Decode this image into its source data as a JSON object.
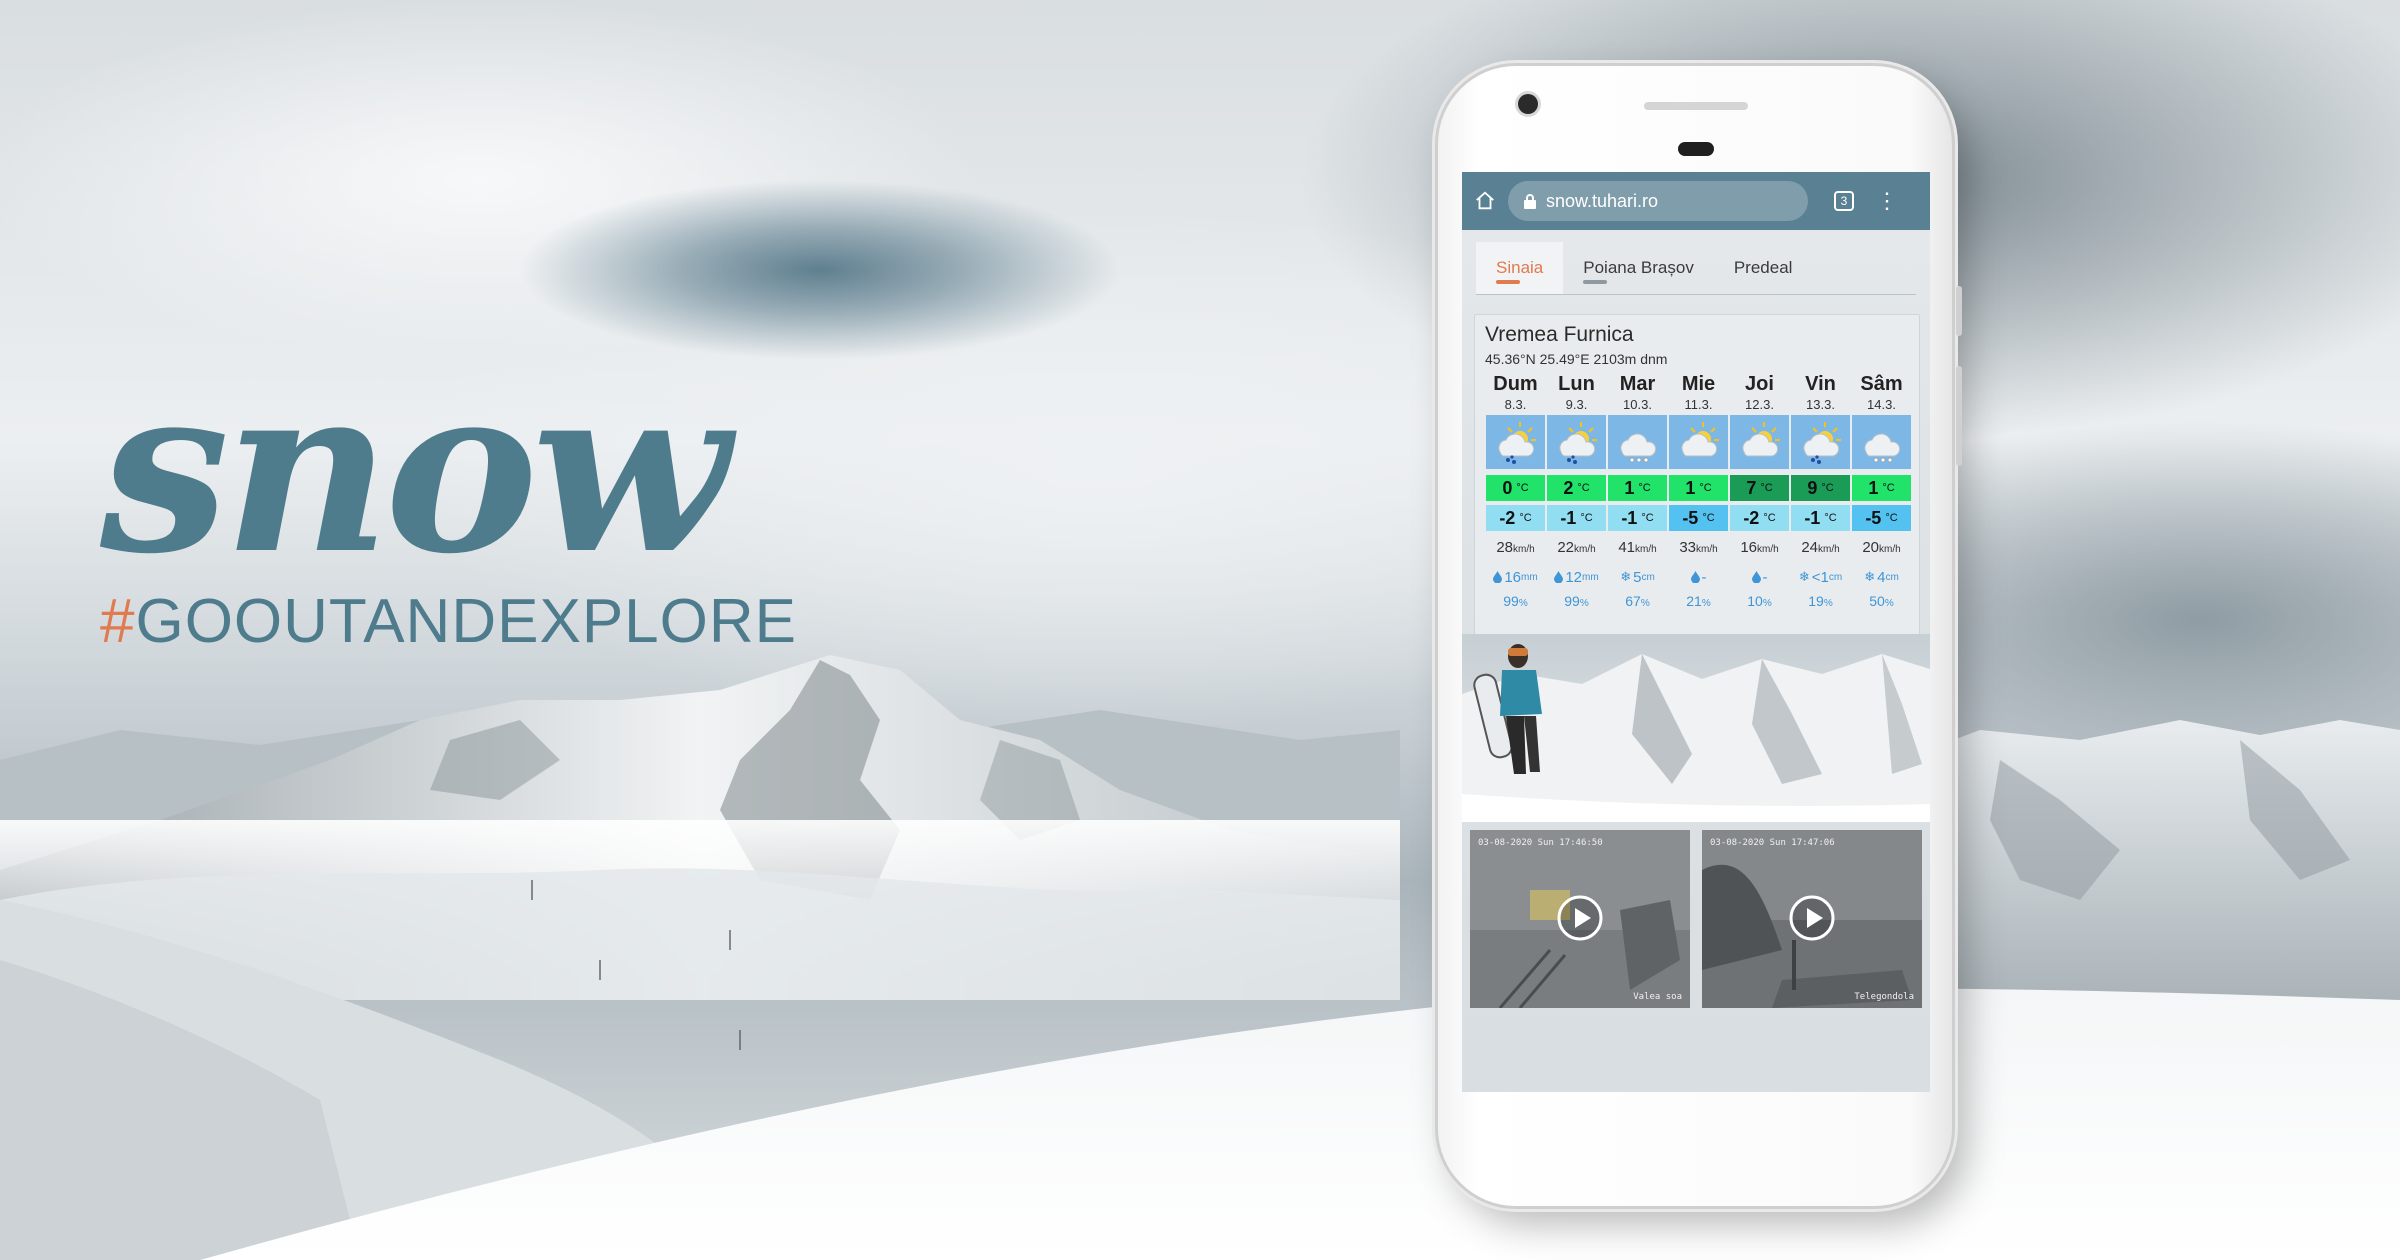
{
  "brand": {
    "word": "snow",
    "hash": "#",
    "tagline": "GOOUTANDEXPLORE",
    "colors": {
      "primary": "#4e7c8c",
      "accent": "#e07a4f"
    }
  },
  "browser": {
    "url": "snow.tuhari.ro",
    "tab_count": "3",
    "home_icon": "home-icon",
    "lock_icon": "lock-icon",
    "menu_icon": "more-vert-icon"
  },
  "locations": [
    {
      "label": "Sinaia",
      "active": true
    },
    {
      "label": "Poiana Brașov",
      "active": false
    },
    {
      "label": "Predeal",
      "active": false
    }
  ],
  "forecast": {
    "title": "Vremea Furnica",
    "coords": "45.36°N 25.49°E 2103m dnm",
    "temp_unit": "°C",
    "wind_unit": "km/h",
    "days": [
      {
        "name": "Dum",
        "date": "8.3.",
        "icon": "sun-cloud-snow-icon",
        "tmax": "0",
        "tmax_color": "#21e36a",
        "tmin": "-2",
        "wind": "28",
        "prec_icon": "drop-icon",
        "prec": "16",
        "prec_unit": "mm",
        "prob": "99",
        "prob_unit": "%"
      },
      {
        "name": "Lun",
        "date": "9.3.",
        "icon": "sun-cloud-snow-icon",
        "tmax": "2",
        "tmax_color": "#21e36a",
        "tmin": "-1",
        "wind": "22",
        "prec_icon": "drop-icon",
        "prec": "12",
        "prec_unit": "mm",
        "prob": "99",
        "prob_unit": "%"
      },
      {
        "name": "Mar",
        "date": "10.3.",
        "icon": "cloud-snow-icon",
        "tmax": "1",
        "tmax_color": "#21e36a",
        "tmin": "-1",
        "wind": "41",
        "prec_icon": "snowflake-icon",
        "prec": "5",
        "prec_unit": "cm",
        "prob": "67",
        "prob_unit": "%"
      },
      {
        "name": "Mie",
        "date": "11.3.",
        "icon": "sun-cloud-icon",
        "tmax": "1",
        "tmax_color": "#21e36a",
        "tmin": "-5",
        "wind": "33",
        "prec_icon": "drop-icon",
        "prec": "-",
        "prec_unit": "",
        "prob": "21",
        "prob_unit": "%"
      },
      {
        "name": "Joi",
        "date": "12.3.",
        "icon": "sun-cloud-icon",
        "tmax": "7",
        "tmax_color": "#1a9c57",
        "tmin": "-2",
        "wind": "16",
        "prec_icon": "drop-icon",
        "prec": "-",
        "prec_unit": "",
        "prob": "10",
        "prob_unit": "%"
      },
      {
        "name": "Vin",
        "date": "13.3.",
        "icon": "sun-cloud-snow-icon",
        "tmax": "9",
        "tmax_color": "#1a9c57",
        "tmin": "-1",
        "wind": "24",
        "prec_icon": "snowflake-icon",
        "prec": "<1",
        "prec_unit": "cm",
        "prob": "19",
        "prob_unit": "%"
      },
      {
        "name": "Sâm",
        "date": "14.3.",
        "icon": "cloud-snow-icon",
        "tmax": "1",
        "tmax_color": "#21e36a",
        "tmin": "-5",
        "wind": "20",
        "prec_icon": "snowflake-icon",
        "prec": "4",
        "prec_unit": "cm",
        "prob": "50",
        "prob_unit": "%"
      }
    ]
  },
  "webcams": [
    {
      "timestamp": "03-08-2020 Sun 17:46:50",
      "name": "Valea soa",
      "play_icon": "play-icon"
    },
    {
      "timestamp": "03-08-2020 Sun 17:47:06",
      "name": "Telegondola",
      "play_icon": "play-icon"
    }
  ]
}
